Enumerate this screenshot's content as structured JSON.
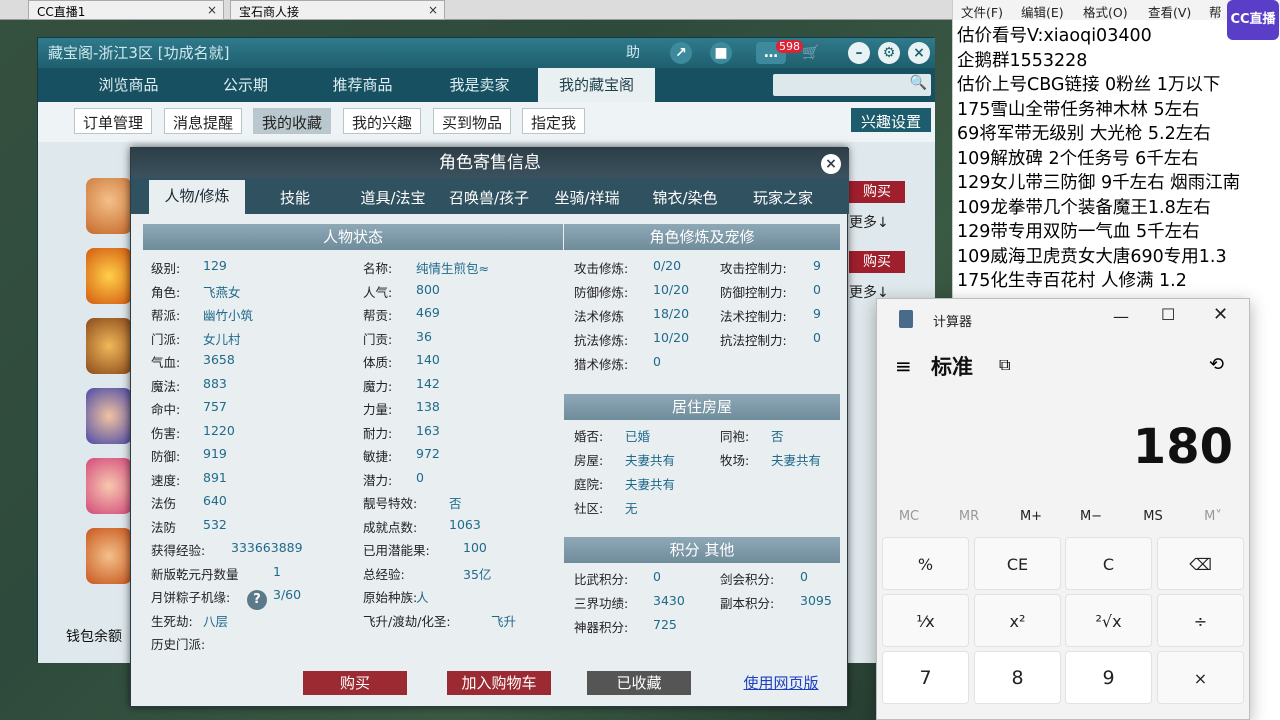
{
  "browser_tabs": [
    {
      "label": "CC直播1",
      "close": "×"
    },
    {
      "label": "宝石商人接",
      "close": "×"
    }
  ],
  "cbg": {
    "title": "藏宝阁-浙江3区 [功成名就]",
    "title_buttons": {
      "help": "助",
      "badge": "598"
    },
    "nav": [
      "浏览商品",
      "公示期",
      "推荐商品",
      "我是卖家",
      "我的藏宝阁"
    ],
    "subtabs": [
      "订单管理",
      "消息提醒",
      "我的收藏",
      "我的兴趣",
      "买到物品",
      "指定我"
    ],
    "interest_setting": "兴趣设置",
    "list_buy": "购买",
    "list_more": "更多↓",
    "wallet": "钱包余额"
  },
  "dialog": {
    "title": "角色寄售信息",
    "tabs": [
      "人物/修炼",
      "技能",
      "道具/法宝",
      "召唤兽/孩子",
      "坐骑/祥瑞",
      "锦衣/染色",
      "玩家之家"
    ],
    "status_head": "人物状态",
    "col1": [
      {
        "label": "级别:",
        "value": "129"
      },
      {
        "label": "角色:",
        "value": "飞燕女"
      },
      {
        "label": "帮派:",
        "value": "幽竹小筑"
      },
      {
        "label": "门派:",
        "value": "女儿村"
      },
      {
        "label": "气血:",
        "value": "3658"
      },
      {
        "label": "魔法:",
        "value": "883"
      },
      {
        "label": "命中:",
        "value": "757"
      },
      {
        "label": "伤害:",
        "value": "1220"
      },
      {
        "label": "防御:",
        "value": "919"
      },
      {
        "label": "速度:",
        "value": "891"
      },
      {
        "label": "法伤",
        "value": "640"
      },
      {
        "label": "法防",
        "value": "532"
      },
      {
        "label": "获得经验:",
        "value": "333663889"
      },
      {
        "label": "新版乾元丹数量",
        "value": "1"
      },
      {
        "label": "月饼粽子机缘:",
        "value": "3/60"
      },
      {
        "label": "生死劫:",
        "value": "八层"
      },
      {
        "label": "历史门派:",
        "value": ""
      }
    ],
    "col2": [
      {
        "label": "名称:",
        "value": "纯情生煎包≈"
      },
      {
        "label": "人气:",
        "value": "800"
      },
      {
        "label": "帮贡:",
        "value": "469"
      },
      {
        "label": "门贡:",
        "value": "36"
      },
      {
        "label": "体质:",
        "value": "140"
      },
      {
        "label": "魔力:",
        "value": "142"
      },
      {
        "label": "力量:",
        "value": "138"
      },
      {
        "label": "耐力:",
        "value": "163"
      },
      {
        "label": "敏捷:",
        "value": "972"
      },
      {
        "label": "潜力:",
        "value": "0"
      },
      {
        "label": "靓号特效:",
        "value": "否"
      },
      {
        "label": "成就点数:",
        "value": "1063"
      },
      {
        "label": "已用潜能果:",
        "value": "100"
      },
      {
        "label": "总经验:",
        "value": "35亿"
      },
      {
        "label": "原始种族:",
        "value": "人"
      },
      {
        "label": "飞升/渡劫/化圣:",
        "value": "飞升"
      }
    ],
    "cultivation_head": "角色修炼及宠修",
    "cultivation": [
      {
        "l1": "攻击修炼:",
        "v1": "0/20",
        "l2": "攻击控制力:",
        "v2": "9"
      },
      {
        "l1": "防御修炼:",
        "v1": "10/20",
        "l2": "防御控制力:",
        "v2": "0"
      },
      {
        "l1": "法术修炼",
        "v1": "18/20",
        "l2": "法术控制力:",
        "v2": "9"
      },
      {
        "l1": "抗法修炼:",
        "v1": "10/20",
        "l2": "抗法控制力:",
        "v2": "0"
      },
      {
        "l1": "猎术修炼:",
        "v1": "0",
        "l2": "",
        "v2": ""
      }
    ],
    "housing_head": "居住房屋",
    "housing": [
      {
        "l1": "婚否:",
        "v1": "已婚",
        "l2": "同袍:",
        "v2": "否"
      },
      {
        "l1": "房屋:",
        "v1": "夫妻共有",
        "l2": "牧场:",
        "v2": "夫妻共有"
      },
      {
        "l1": "庭院:",
        "v1": "夫妻共有",
        "l2": "",
        "v2": ""
      },
      {
        "l1": "社区:",
        "v1": "无",
        "l2": "",
        "v2": ""
      }
    ],
    "points_head": "积分 其他",
    "points": [
      {
        "l1": "比武积分:",
        "v1": "0",
        "l2": "剑会积分:",
        "v2": "0"
      },
      {
        "l1": "三界功绩:",
        "v1": "3430",
        "l2": "副本积分:",
        "v2": "3095"
      },
      {
        "l1": "神器积分:",
        "v1": "725",
        "l2": "",
        "v2": ""
      }
    ],
    "buttons": {
      "buy": "购买",
      "cart": "加入购物车",
      "favorited": "已收藏",
      "web": "使用网页版"
    }
  },
  "notepad": {
    "menu": [
      "文件(F)",
      "编辑(E)",
      "格式(O)",
      "查看(V)",
      "帮"
    ],
    "logo": "CC直播",
    "lines": [
      "估价看号V:xiaoqi03400",
      "企鹅群1553228",
      "估价上号CBG链接 0粉丝 1万以下",
      "175雪山全带任务神木林 5左右",
      "69将军带无级别 大光枪 5.2左右",
      "109解放碑 2个任务号 6千左右",
      "129女儿带三防御 9千左右 烟雨江南",
      "109龙拳带几个装备魔王1.8左右",
      "129带专用双防一气血 5千左右",
      "109威海卫虎贲女大唐690专用1.3",
      "175化生寺百花村 人修满 1.2"
    ]
  },
  "calculator": {
    "title": "计算器",
    "mode": "标准",
    "display": "180",
    "memory": [
      "MC",
      "MR",
      "M+",
      "M−",
      "MS",
      "M˅"
    ],
    "keys": [
      [
        "%",
        "CE",
        "C",
        "⌫"
      ],
      [
        "¹⁄x",
        "x²",
        "²√x",
        "÷"
      ],
      [
        "7",
        "8",
        "9",
        "×"
      ]
    ]
  }
}
